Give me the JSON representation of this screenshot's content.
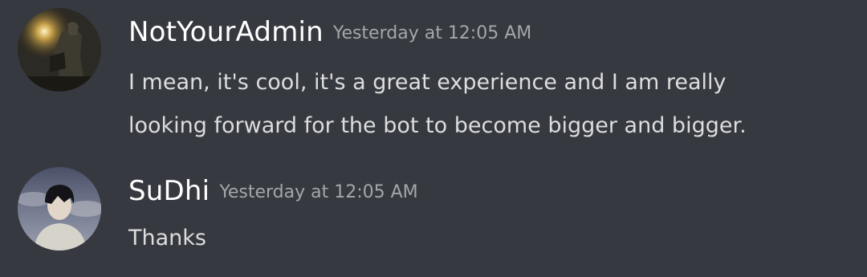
{
  "messages": [
    {
      "username": "NotYourAdmin",
      "timestamp": "Yesterday at 12:05 AM",
      "avatar_icon": "user-avatar-dark-photo",
      "lines": [
        "I mean, it's cool, it's a great experience and I am really",
        "looking forward for the bot to become bigger and bigger."
      ]
    },
    {
      "username": "SuDhi",
      "timestamp": "Yesterday at 12:05 AM",
      "avatar_icon": "user-avatar-anime-portrait",
      "lines": [
        "Thanks"
      ]
    }
  ],
  "colors": {
    "background": "#36393f",
    "username": "#ffffff",
    "timestamp": "#a3a6aa",
    "message_text": "#dcddde"
  }
}
